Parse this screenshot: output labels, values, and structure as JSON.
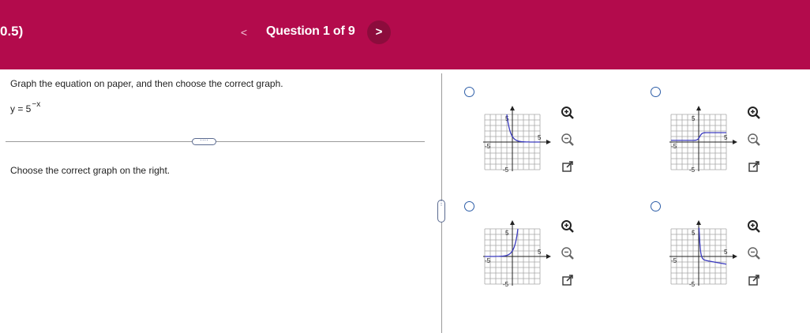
{
  "header": {
    "section_number": "0.5)",
    "prev_label": "<",
    "question_title": "Question 1 of 9",
    "next_label": ">",
    "background_color": "#b30b4c"
  },
  "left_pane": {
    "instruction": "Graph the equation on paper, and then choose the correct graph.",
    "equation_base": "y = 5",
    "equation_exponent": "−x",
    "more_button_label": "····",
    "choose_text": "Choose the correct graph on the right."
  },
  "splitter": {
    "handle_label": "⋮"
  },
  "options": [
    {
      "id": "A",
      "tick_left": "-5",
      "tick_right": "5",
      "tick_top": "5",
      "tick_bottom": "-5",
      "curve": "decay-from-top"
    },
    {
      "id": "B",
      "tick_left": "-5",
      "tick_right": "5",
      "tick_top": "5",
      "tick_bottom": "-5",
      "curve": "step-up"
    },
    {
      "id": "C",
      "tick_left": "-5",
      "tick_right": "5",
      "tick_top": "5",
      "tick_bottom": "-5",
      "curve": "growth-to-top"
    },
    {
      "id": "D",
      "tick_left": "-5",
      "tick_right": "5",
      "tick_top": "5",
      "tick_bottom": "-5",
      "curve": "decay-down-right"
    }
  ],
  "tools": {
    "zoom_in": "zoom-in-icon",
    "zoom_out": "zoom-out-icon",
    "popout": "popout-icon"
  },
  "colors": {
    "curve": "#3b3bbf",
    "radio": "#2e5ea8",
    "grid": "#9a9a9a"
  }
}
